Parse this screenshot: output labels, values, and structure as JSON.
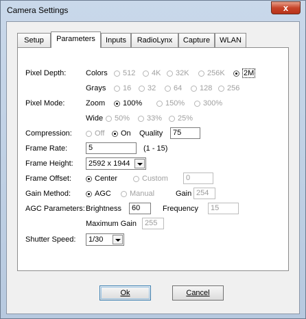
{
  "window": {
    "title": "Camera Settings",
    "close_glyph": "x"
  },
  "tabs": [
    {
      "label": "Setup",
      "active": false
    },
    {
      "label": "Parameters",
      "active": true
    },
    {
      "label": "Inputs",
      "active": false
    },
    {
      "label": "RadioLynx",
      "active": false
    },
    {
      "label": "Capture",
      "active": false
    },
    {
      "label": "WLAN",
      "active": false
    }
  ],
  "pixel_depth": {
    "label": "Pixel Depth:",
    "colors_label": "Colors",
    "colors_options": [
      "512",
      "4K",
      "32K",
      "256K",
      "2M"
    ],
    "colors_selected": "2M",
    "grays_label": "Grays",
    "grays_options": [
      "16",
      "32",
      "64",
      "128",
      "256"
    ]
  },
  "pixel_mode": {
    "label": "Pixel Mode:",
    "zoom_label": "Zoom",
    "zoom_options": [
      "100%",
      "150%",
      "300%"
    ],
    "zoom_selected": "100%",
    "wide_label": "Wide",
    "wide_options": [
      "50%",
      "33%",
      "25%"
    ]
  },
  "compression": {
    "label": "Compression:",
    "options": [
      "Off",
      "On"
    ],
    "selected": "On",
    "quality_label": "Quality",
    "quality_value": "75"
  },
  "frame_rate": {
    "label": "Frame Rate:",
    "value": "5",
    "range": "(1 - 15)"
  },
  "frame_height": {
    "label": "Frame Height:",
    "value": "2592 x 1944"
  },
  "frame_offset": {
    "label": "Frame Offset:",
    "options": [
      "Center",
      "Custom"
    ],
    "selected": "Center",
    "custom_value": "0"
  },
  "gain_method": {
    "label": "Gain Method:",
    "options": [
      "AGC",
      "Manual"
    ],
    "selected": "AGC",
    "gain_label": "Gain",
    "gain_value": "254"
  },
  "agc_parameters": {
    "label": "AGC Parameters:",
    "brightness_label": "Brightness",
    "brightness_value": "60",
    "frequency_label": "Frequency",
    "frequency_value": "15",
    "max_gain_label": "Maximum Gain",
    "max_gain_value": "255"
  },
  "shutter_speed": {
    "label": "Shutter Speed:",
    "value": "1/30"
  },
  "buttons": {
    "ok": "Ok",
    "cancel": "Cancel"
  }
}
